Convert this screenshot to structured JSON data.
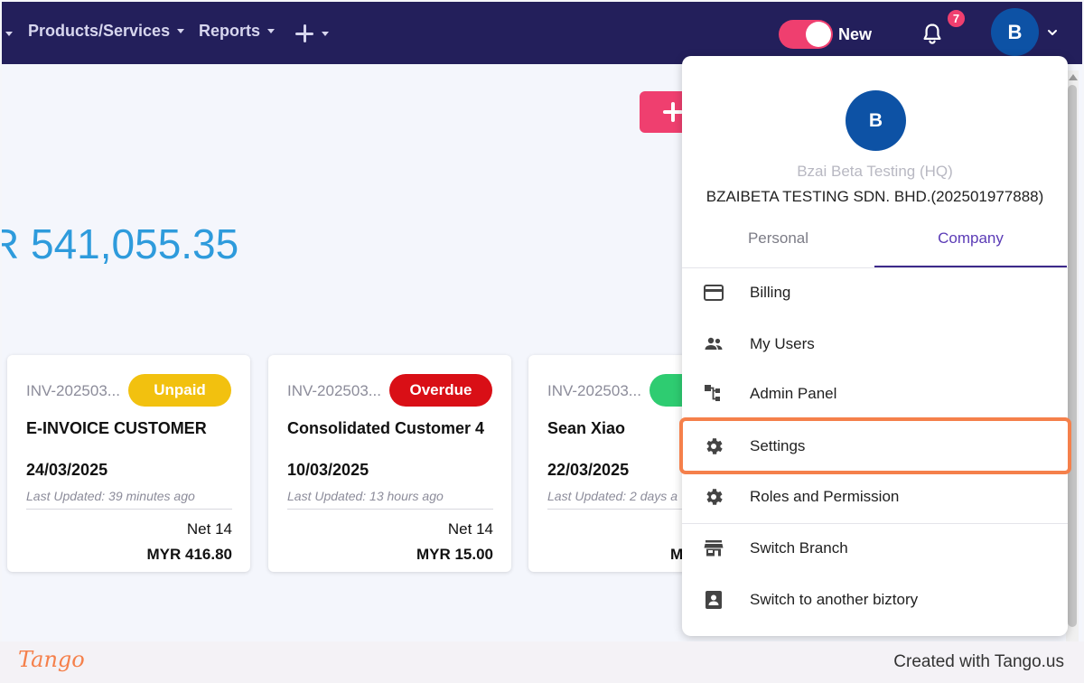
{
  "navbar": {
    "items": [
      {
        "label": "Products/Services"
      },
      {
        "label": "Reports"
      }
    ],
    "toggle_label": "New",
    "notification_count": "7",
    "user_initial": "B",
    "colors": {
      "bar": "#231f5b",
      "accent": "#ef3f6f",
      "avatar": "#0d52a5"
    }
  },
  "main": {
    "total_amount": "R 541,055.35",
    "invoices": [
      {
        "invoice_no": "INV-202503...",
        "status": "Unpaid",
        "status_color": "#f2c10f",
        "customer": "E-INVOICE CUSTOMER",
        "date": "24/03/2025",
        "updated": "Last Updated: 39 minutes ago",
        "terms": "Net 14",
        "amount": "MYR 416.80"
      },
      {
        "invoice_no": "INV-202503...",
        "status": "Overdue",
        "status_color": "#d90f16",
        "customer": "Consolidated Customer 4",
        "date": "10/03/2025",
        "updated": "Last Updated: 13 hours ago",
        "terms": "Net 14",
        "amount": "MYR 15.00"
      },
      {
        "invoice_no": "INV-202503...",
        "status": "",
        "status_color": "#2ecc71",
        "customer": "Sean Xiao",
        "date": "22/03/2025",
        "updated": "Last Updated: 2 days a",
        "terms": "",
        "amount": "M"
      }
    ]
  },
  "dropdown": {
    "avatar_initial": "B",
    "company_name": "Bzai Beta Testing (HQ)",
    "company_legal": "BZAIBETA TESTING SDN. BHD.(202501977888)",
    "tabs": [
      {
        "label": "Personal",
        "active": false
      },
      {
        "label": "Company",
        "active": true
      }
    ],
    "menu": [
      {
        "label": "Billing",
        "icon": "credit-card-icon"
      },
      {
        "label": "My Users",
        "icon": "users-icon"
      },
      {
        "label": "Admin Panel",
        "icon": "hierarchy-icon"
      },
      {
        "label": "Settings",
        "icon": "gear-icon"
      },
      {
        "label": "Roles and Permission",
        "icon": "gear-icon"
      },
      {
        "label": "Switch Branch",
        "icon": "store-icon"
      },
      {
        "label": "Switch to another biztory",
        "icon": "contact-card-icon"
      }
    ]
  },
  "footer": {
    "logo": "Tango",
    "credit": "Created with Tango.us"
  }
}
